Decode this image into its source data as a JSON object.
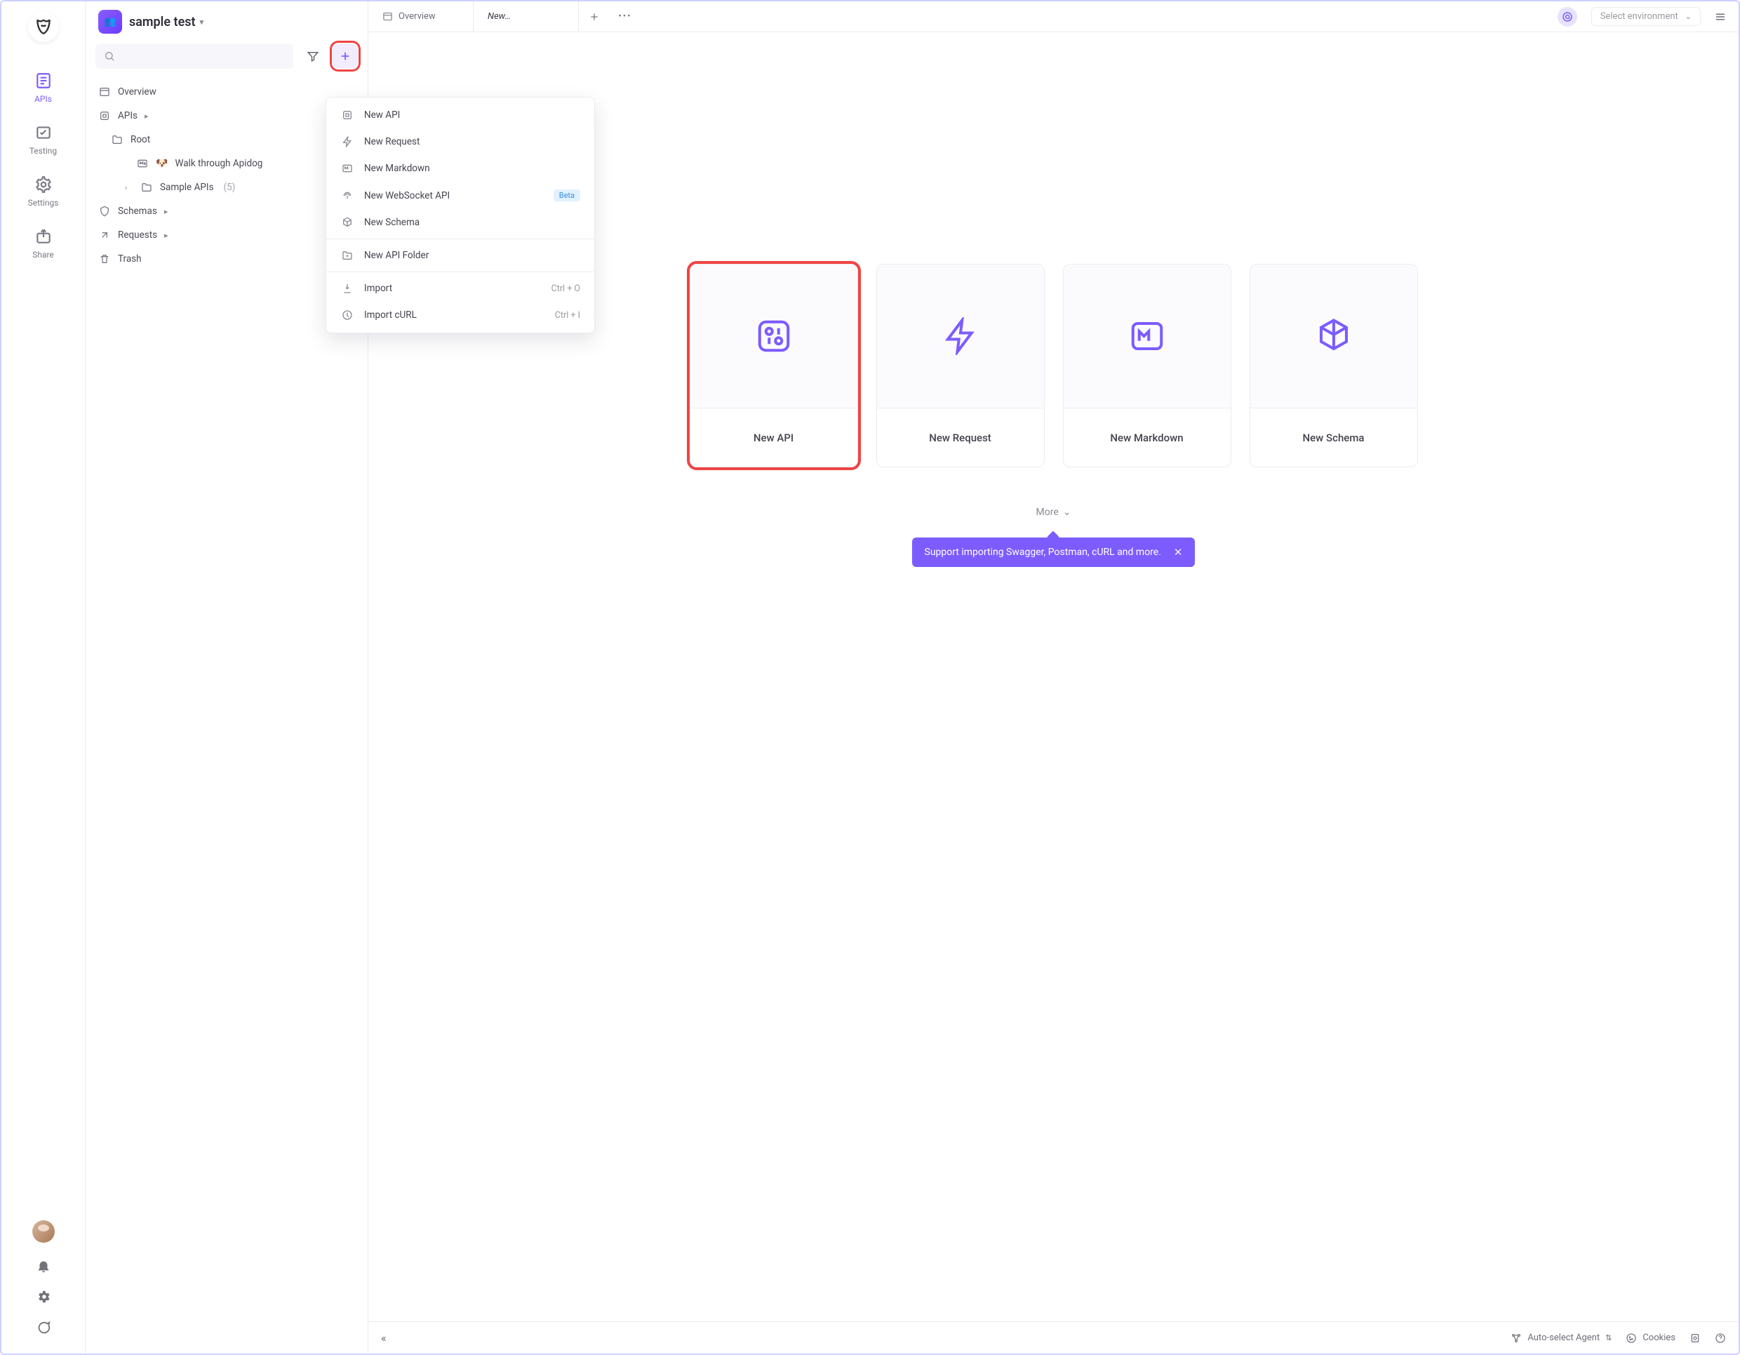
{
  "workspace": {
    "name": "sample test"
  },
  "rail": {
    "items": [
      {
        "label": "APIs",
        "active": true
      },
      {
        "label": "Testing",
        "active": false
      },
      {
        "label": "Settings",
        "active": false
      },
      {
        "label": "Share",
        "active": false
      }
    ]
  },
  "tree": {
    "overview": "Overview",
    "apis": {
      "label": "APIs"
    },
    "root": {
      "label": "Root"
    },
    "walkthrough": {
      "label": "Walk through Apidog",
      "emoji": "🐶"
    },
    "sampleApis": {
      "label": "Sample APIs",
      "count": "(5)"
    },
    "schemas": {
      "label": "Schemas"
    },
    "requests": {
      "label": "Requests"
    },
    "trash": {
      "label": "Trash"
    }
  },
  "dropdown": {
    "items": [
      {
        "label": "New API"
      },
      {
        "label": "New Request"
      },
      {
        "label": "New Markdown"
      },
      {
        "label": "New WebSocket API",
        "badge": "Beta"
      },
      {
        "label": "New Schema"
      }
    ],
    "folder": {
      "label": "New API Folder"
    },
    "import": {
      "label": "Import",
      "shortcut": "Ctrl + O"
    },
    "importCurl": {
      "label": "Import cURL",
      "shortcut": "Ctrl + I"
    }
  },
  "tabs": {
    "overview": "Overview",
    "new": "New…"
  },
  "env": {
    "placeholder": "Select environment"
  },
  "cards": {
    "api": "New API",
    "request": "New Request",
    "markdown": "New Markdown",
    "schema": "New Schema",
    "more": "More"
  },
  "tip": {
    "text": "Support importing Swagger, Postman, cURL and more."
  },
  "status": {
    "agent": "Auto-select Agent",
    "cookies": "Cookies"
  }
}
